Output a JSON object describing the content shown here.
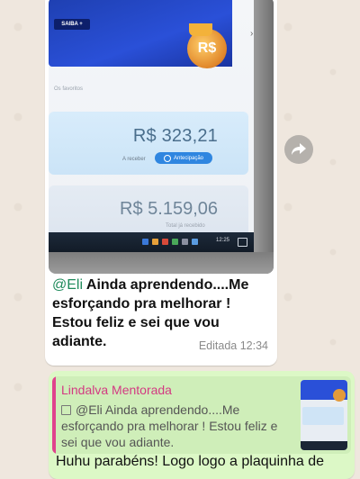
{
  "incoming_message": {
    "photo": {
      "banner_button": "SAIBA +",
      "banner_coin": "R$",
      "faded_label": "Os favoritos",
      "balance_amount": "R$ 323,21",
      "receivable_label": "A receber",
      "advance_button": "Antecipação",
      "total_amount": "R$ 5.159,06",
      "total_label": "Total já recebido",
      "taskbar_clock": "12:25"
    },
    "mention": "@Eli",
    "caption": "Ainda aprendendo....Me esforçando pra melhorar ! Estou feliz e sei que vou adiante.",
    "status": "Editada",
    "time": "12:34"
  },
  "outgoing_message": {
    "quote_author": "Lindalva Mentorada",
    "quote_text": "@Eli Ainda aprendendo....Me esforçando pra melhorar ! Estou feliz e sei que vou adiante.",
    "reply_text": "Huhu parabéns! Logo logo a plaquinha de"
  },
  "icons": {
    "forward": "forward-icon",
    "quote_media": "image-icon"
  },
  "colors": {
    "incoming_bubble": "#ffffff",
    "outgoing_bubble": "#dcf8c6",
    "mention": "#1f8a5b",
    "quote_author": "#d33a82"
  }
}
